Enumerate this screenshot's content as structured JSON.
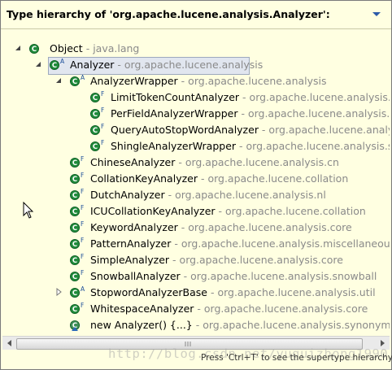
{
  "header": {
    "title": "Type hierarchy of 'org.apache.lucene.analysis.Analyzer':",
    "menu_icon": "chevron-down-icon"
  },
  "tree": [
    {
      "name": "Object",
      "pkg": "java.lang",
      "icon": "class-icon",
      "twisty": "expanded"
    },
    {
      "name": "Analyzer",
      "pkg": "org.apache.lucene.analysis",
      "icon": "abstract-class-icon",
      "twisty": "expanded",
      "selected": true
    },
    {
      "name": "AnalyzerWrapper",
      "pkg": "org.apache.lucene.analysis",
      "icon": "abstract-class-icon",
      "twisty": "expanded"
    },
    {
      "name": "LimitTokenCountAnalyzer",
      "pkg": "org.apache.lucene.analysis.misc",
      "icon": "final-class-icon"
    },
    {
      "name": "PerFieldAnalyzerWrapper",
      "pkg": "org.apache.lucene.analysis.misc",
      "icon": "final-class-icon"
    },
    {
      "name": "QueryAutoStopWordAnalyzer",
      "pkg": "org.apache.lucene.analysis",
      "icon": "final-class-icon"
    },
    {
      "name": "ShingleAnalyzerWrapper",
      "pkg": "org.apache.lucene.analysis.shing",
      "icon": "final-class-icon"
    },
    {
      "name": "ChineseAnalyzer",
      "pkg": "org.apache.lucene.analysis.cn",
      "icon": "final-class-icon"
    },
    {
      "name": "CollationKeyAnalyzer",
      "pkg": "org.apache.lucene.collation",
      "icon": "final-class-icon"
    },
    {
      "name": "DutchAnalyzer",
      "pkg": "org.apache.lucene.analysis.nl",
      "icon": "final-class-icon"
    },
    {
      "name": "ICUCollationKeyAnalyzer",
      "pkg": "org.apache.lucene.collation",
      "icon": "final-class-icon"
    },
    {
      "name": "KeywordAnalyzer",
      "pkg": "org.apache.lucene.analysis.core",
      "icon": "final-class-icon"
    },
    {
      "name": "PatternAnalyzer",
      "pkg": "org.apache.lucene.analysis.miscellaneous",
      "icon": "final-class-icon"
    },
    {
      "name": "SimpleAnalyzer",
      "pkg": "org.apache.lucene.analysis.core",
      "icon": "final-class-icon"
    },
    {
      "name": "SnowballAnalyzer",
      "pkg": "org.apache.lucene.analysis.snowball",
      "icon": "final-class-icon"
    },
    {
      "name": "StopwordAnalyzerBase",
      "pkg": "org.apache.lucene.analysis.util",
      "icon": "abstract-class-icon",
      "twisty": "collapsed"
    },
    {
      "name": "WhitespaceAnalyzer",
      "pkg": "org.apache.lucene.analysis.core",
      "icon": "final-class-icon"
    },
    {
      "name": "new Analyzer() {...}",
      "pkg": "org.apache.lucene.analysis.synonym",
      "icon": "anonymous-class-icon"
    }
  ],
  "separator": " - ",
  "status": "Press 'Ctrl+T' to see the supertype hierarchy",
  "watermark": "http://blog.csdn.net/yuguizhong1990",
  "colors": {
    "background": "#ffffe1",
    "class_green": "#1f8a3a",
    "package_gray": "#8a8a8a",
    "selection": "#e1e6ef"
  }
}
